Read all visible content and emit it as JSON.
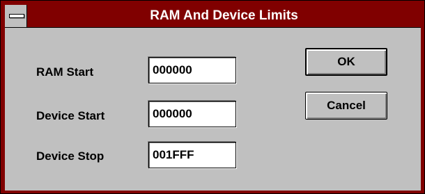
{
  "dialog": {
    "title": "RAM And Device Limits",
    "fields": [
      {
        "label": "RAM Start",
        "value": "000000"
      },
      {
        "label": "Device Start",
        "value": "000000"
      },
      {
        "label": "Device Stop",
        "value": "001FFF"
      }
    ],
    "buttons": {
      "ok_label": "OK",
      "cancel_label": "Cancel"
    }
  },
  "colors": {
    "title_bar": "#800000",
    "face": "#c0c0c0",
    "title_text": "#ffffff"
  },
  "icons": {
    "system_menu": "system-menu-icon"
  }
}
